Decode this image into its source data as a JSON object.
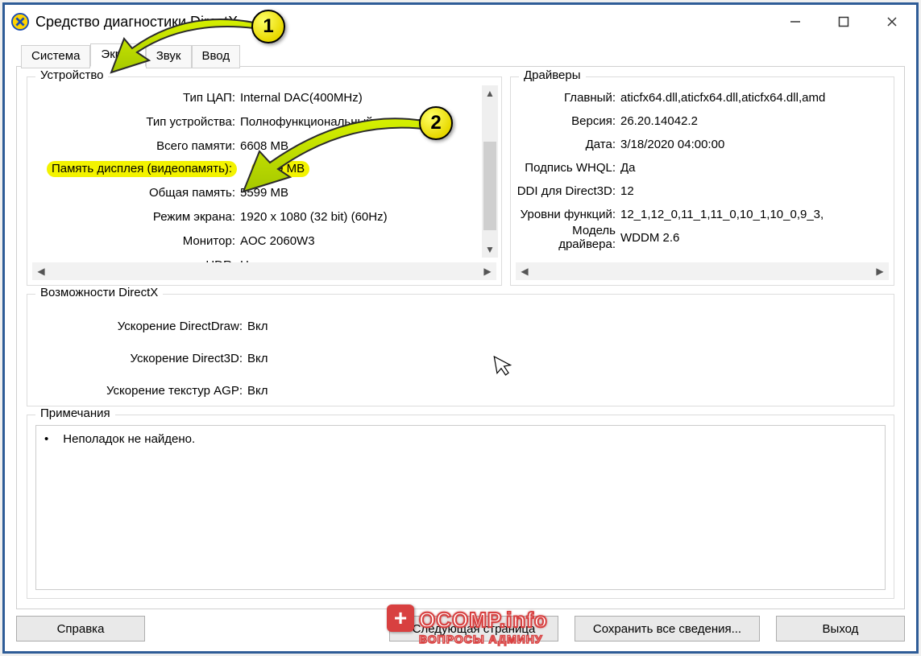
{
  "window": {
    "title": "Средство диагностики DirectX"
  },
  "tabs": {
    "system": "Система",
    "display": "Экран",
    "sound": "Звук",
    "input": "Ввод"
  },
  "groups": {
    "device": "Устройство",
    "drivers": "Драйверы",
    "dx": "Возможности DirectX",
    "notes": "Примечания"
  },
  "device": {
    "dac_type_k": "Тип ЦАП:",
    "dac_type_v": "Internal DAC(400MHz)",
    "dev_type_k": "Тип устройства:",
    "dev_type_v": "Полнофункциональный видеоадапте",
    "total_mem_k": "Всего памяти:",
    "total_mem_v": "6608 MB",
    "disp_mem_k": "Память дисплея (видеопамять):",
    "disp_mem_v": "1009 MB",
    "shared_mem_k": "Общая память:",
    "shared_mem_v": "5599 MB",
    "mode_k": "Режим экрана:",
    "mode_v": "1920 x 1080 (32 bit) (60Hz)",
    "monitor_k": "Монитор:",
    "monitor_v": "AOC 2060W3",
    "hdr_k": "HDR:",
    "hdr_v": "Не поддерживается"
  },
  "drivers": {
    "main_k": "Главный:",
    "main_v": "aticfx64.dll,aticfx64.dll,aticfx64.dll,amd",
    "version_k": "Версия:",
    "version_v": "26.20.14042.2",
    "date_k": "Дата:",
    "date_v": "3/18/2020 04:00:00",
    "whql_k": "Подпись WHQL:",
    "whql_v": "Да",
    "ddi_k": "DDI для Direct3D:",
    "ddi_v": "12",
    "feat_k": "Уровни функций:",
    "feat_v": "12_1,12_0,11_1,11_0,10_1,10_0,9_3,",
    "model_k": "Модель драйвера:",
    "model_v": "WDDM 2.6"
  },
  "dx": {
    "dd_k": "Ускорение DirectDraw:",
    "dd_v": "Вкл",
    "d3d_k": "Ускорение Direct3D:",
    "d3d_v": "Вкл",
    "agp_k": "Ускорение текстур AGP:",
    "agp_v": "Вкл"
  },
  "notes": {
    "line": "Неполадок не найдено."
  },
  "buttons": {
    "help": "Справка",
    "next": "Следующая страница",
    "save": "Сохранить все сведения...",
    "exit": "Выход"
  },
  "markers": {
    "one": "1",
    "two": "2"
  },
  "watermark": {
    "line1": "OCOMP.info",
    "line2": "ВОПРОСЫ АДМИНУ"
  }
}
